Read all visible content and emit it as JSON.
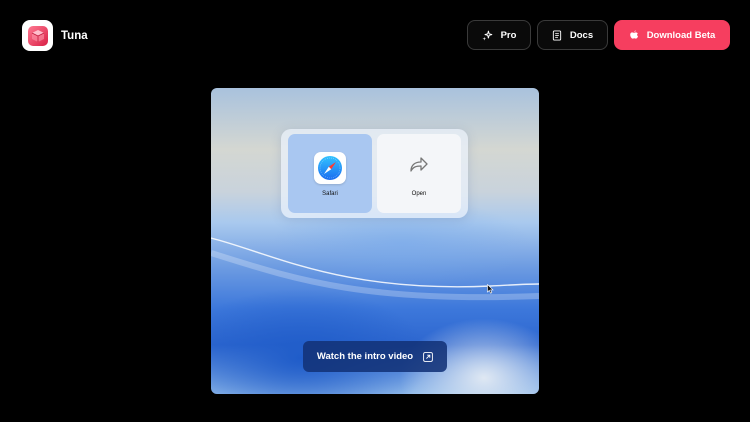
{
  "brand": {
    "name": "Tuna",
    "logo_icon": "cube-logo-icon",
    "logo_color": "#f63e5f"
  },
  "nav": {
    "pro_label": "Pro",
    "pro_icon": "sparkles-icon",
    "docs_label": "Docs",
    "docs_icon": "document-icon",
    "download_label": "Download Beta",
    "download_icon": "apple-icon",
    "download_color": "#f63e5f"
  },
  "hero": {
    "share_panel": {
      "items": [
        {
          "label": "Safari",
          "icon": "safari-icon"
        },
        {
          "label": "Open",
          "icon": "share-arrow-icon"
        }
      ]
    },
    "video_button": {
      "label": "Watch the intro video",
      "icon": "external-link-icon"
    }
  }
}
